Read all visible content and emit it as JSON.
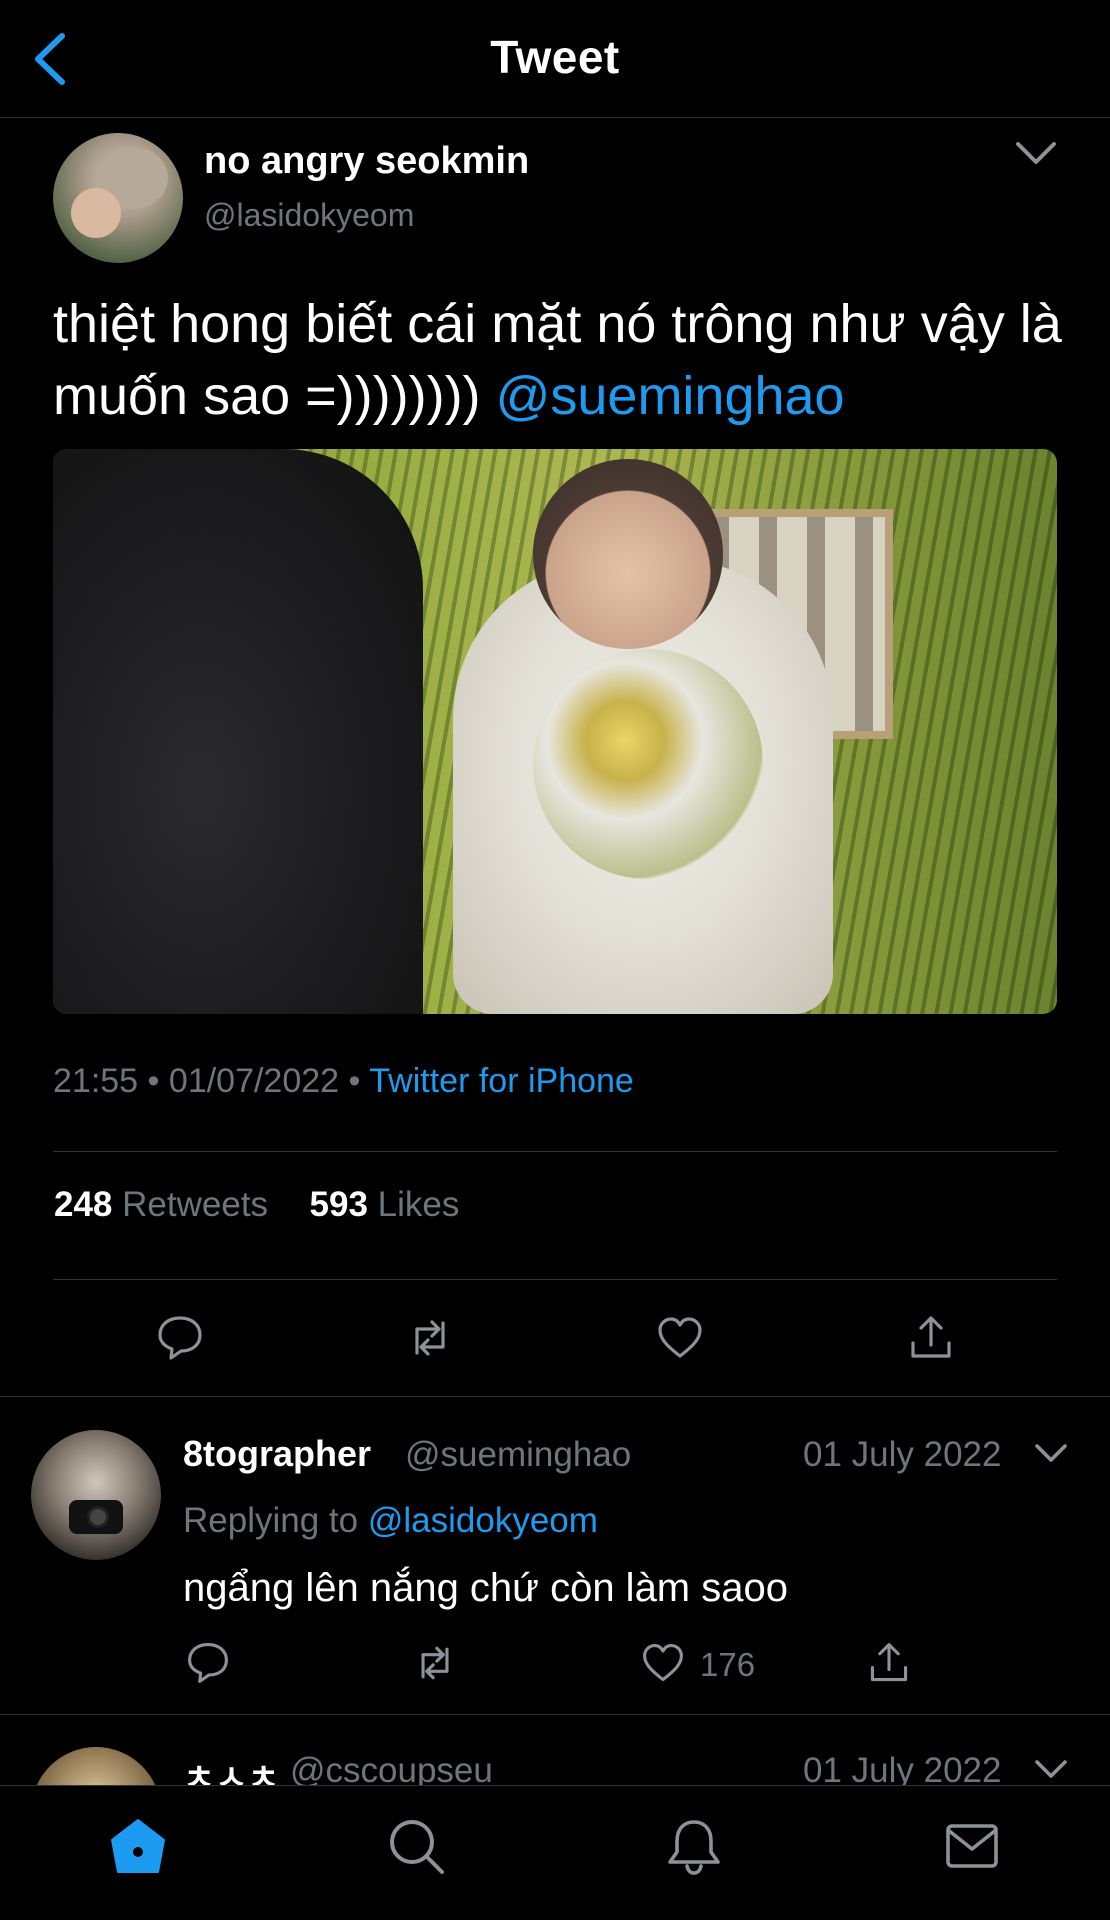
{
  "header": {
    "title": "Tweet",
    "back_icon": "chevron-left-icon"
  },
  "tweet": {
    "author_name": "no angry seokmin",
    "author_handle": "@lasidokyeom",
    "text": "thiệt hong biết cái mặt nó trông như vậy là muốn sao =))))))))",
    "mention": "@sueminghao",
    "time": "21:55",
    "date": "01/07/2022",
    "separator": "•",
    "source": "Twitter for iPhone",
    "retweets_count": "248",
    "retweets_label": "Retweets",
    "likes_count": "593",
    "likes_label": "Likes"
  },
  "reply": {
    "name": "8tographer",
    "handle": "@sueminghao",
    "date": "01 July 2022",
    "replying_prefix": "Replying to",
    "replying_to": "@lasidokyeom",
    "text": "ngẩng lên nắng chứ còn làm saoo",
    "like_count": "176"
  },
  "next_reply": {
    "name": "ㅊㅅㅊ",
    "handle": "@cscoupseu",
    "date": "01 July 2022"
  },
  "tabbar": {
    "items": [
      "home-icon",
      "search-icon",
      "notifications-icon",
      "messages-icon"
    ],
    "active": "home-icon"
  },
  "colors": {
    "background": "#000000",
    "accent": "#1d9bf0",
    "secondary_text": "#6e767d",
    "divider": "#2f3336"
  }
}
